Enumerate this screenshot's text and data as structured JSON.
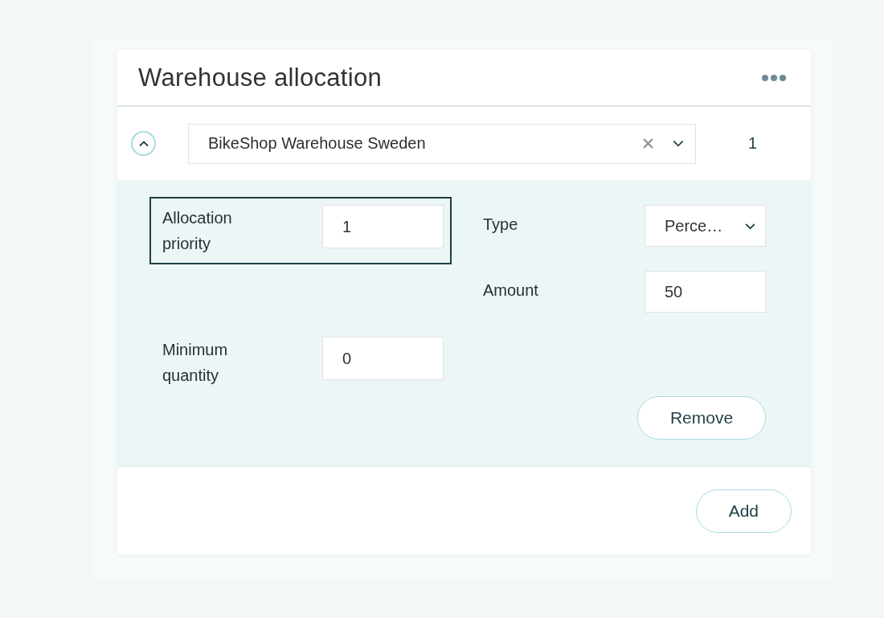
{
  "card": {
    "title": "Warehouse allocation"
  },
  "allocation": {
    "expanded": true,
    "warehouse": "BikeShop Warehouse Sweden",
    "priority_number": "1",
    "left_fields": [
      {
        "kind": "input",
        "label": "Allocation priority",
        "value": "1",
        "focused": true
      },
      {
        "kind": "input",
        "label": "Minimum quantity",
        "value": "0",
        "focused": false
      }
    ],
    "right_fields": [
      {
        "kind": "select",
        "label": "Type",
        "value": "Perce…",
        "focused": false
      },
      {
        "kind": "input",
        "label": "Amount",
        "value": "50",
        "focused": false
      }
    ],
    "remove_button": "Remove"
  },
  "add_button": "Add"
}
